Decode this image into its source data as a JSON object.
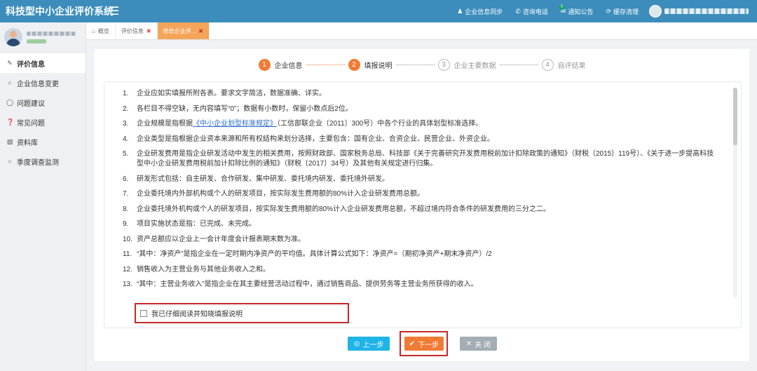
{
  "header": {
    "title": "科技型中小企业评价系统",
    "actions": [
      {
        "icon": "user-icon",
        "label": "企业信息同步"
      },
      {
        "icon": "phone-icon",
        "label": "咨询电话"
      },
      {
        "icon": "message-icon",
        "label": "通知公告",
        "badge": "0"
      },
      {
        "icon": "refresh-icon",
        "label": "缓存清理"
      }
    ]
  },
  "sidebar": {
    "items": [
      {
        "icon": "edit-icon",
        "label": "评价信息",
        "active": true
      },
      {
        "icon": "circle-icon",
        "label": "企业信息变更"
      },
      {
        "icon": "chat-icon",
        "label": "问题建议"
      },
      {
        "icon": "question-icon",
        "label": "常见问题"
      },
      {
        "icon": "folder-icon",
        "label": "资料库"
      },
      {
        "icon": "circle-icon",
        "label": "季度调查监测"
      }
    ]
  },
  "tabs": [
    {
      "icon": "home-icon",
      "label": "概览"
    },
    {
      "label": "评价信息",
      "closable": true
    },
    {
      "label": "修改企业评...",
      "closable": true,
      "active": true
    }
  ],
  "steps": [
    {
      "num": "1",
      "label": "企业信息",
      "state": "done"
    },
    {
      "num": "2",
      "label": "填报说明",
      "state": "done"
    },
    {
      "num": "3",
      "label": "企业主要数据",
      "state": "todo"
    },
    {
      "num": "4",
      "label": "自评结果",
      "state": "todo"
    }
  ],
  "notice": {
    "items": [
      {
        "num": "1.",
        "text": "企业应如实填报所附各表。要求文字简洁，数据准确、详实。"
      },
      {
        "num": "2.",
        "text": "各栏目不得空缺，无内容填写“0”；数据有小数时，保留小数点后2位。"
      },
      {
        "num": "3.",
        "pre": "企业规模是指根据",
        "link": "《中小企业划型标准规定》",
        "post": "（工信部联企业〔2011〕300号）中各个行业的具体划型标准选择。"
      },
      {
        "num": "4.",
        "text": "企业类型是指根据企业资本来源和所有权结构来划分选择，主要包含：国有企业、合资企业、民营企业、外资企业。"
      },
      {
        "num": "5.",
        "text": "企业研发费用是指企业研发活动中发生的相关费用，按照财政部、国家税务总局、科技部《关于完善研究开发费用税前加计扣除政策的通知》（财税〔2015〕119号）、《关于进一步提高科技型中小企业研发费用税前加计扣除比例的通知》（财税〔2017〕34号）及其他有关规定进行归集。"
      },
      {
        "num": "6.",
        "text": "研发形式包括：自主研发、合作研发、集中研发、委托境内研发、委托境外研发。"
      },
      {
        "num": "7.",
        "text": "企业委托境内外部机构或个人的研发项目，按实际发生费用额的80%计入企业研发费用总额。"
      },
      {
        "num": "8.",
        "text": "企业委托境外机构或个人的研发项目，按实际发生费用额的80%计入企业研发费用总额，不超过境内符合条件的研发费用的三分之二。"
      },
      {
        "num": "9.",
        "text": "项目实施状态是指：已完成、未完成。"
      },
      {
        "num": "10.",
        "text": "资产总额应以企业上一会计年度会计报表期末数为准。"
      },
      {
        "num": "11.",
        "text": "“其中：净资产”是指企业在一定时期内净资产的平均值。具体计算公式如下：净资产=（期初净资产+期末净资产）/2"
      },
      {
        "num": "12.",
        "text": "销售收入为主营业务与其他业务收入之和。"
      },
      {
        "num": "13.",
        "text": "“其中：主营业务收入”是指企业在其主要经营活动过程中，通过销售商品、提供劳务等主营业务所获得的收入。"
      }
    ]
  },
  "agree_label": "我已仔细阅读并知晓填报说明",
  "buttons": {
    "prev": "上一步",
    "next": "下一步",
    "close": "关 闭"
  },
  "colors": {
    "header": "#3c8dbc",
    "accent_orange": "#f07b35",
    "prev_blue": "#1fb4e8",
    "close_grey": "#a4acb4",
    "highlight_red": "#c62828"
  }
}
